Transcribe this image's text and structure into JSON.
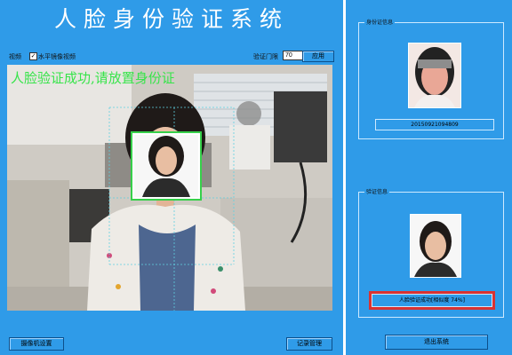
{
  "title": "人脸身份验证系统",
  "toolbar": {
    "video_label": "视频",
    "mirror_label": "水平镜像视频",
    "threshold_label": "验证门限",
    "threshold_value": "70",
    "apply_label": "应用"
  },
  "overlay_message": "人脸验证成功,请放置身份证",
  "bottom": {
    "camera_settings": "摄像机设置",
    "records": "记录管理"
  },
  "id_panel": {
    "title": "身份证信息",
    "id_number": "2015092109480​9"
  },
  "verify_panel": {
    "title": "验证信息",
    "result": "人脸验证成功[相似度  74%]"
  },
  "exit_label": "退出系统",
  "colors": {
    "window_blue": "#2f9be8",
    "overlay_green": "#37e44a",
    "result_border": "#d93232"
  }
}
